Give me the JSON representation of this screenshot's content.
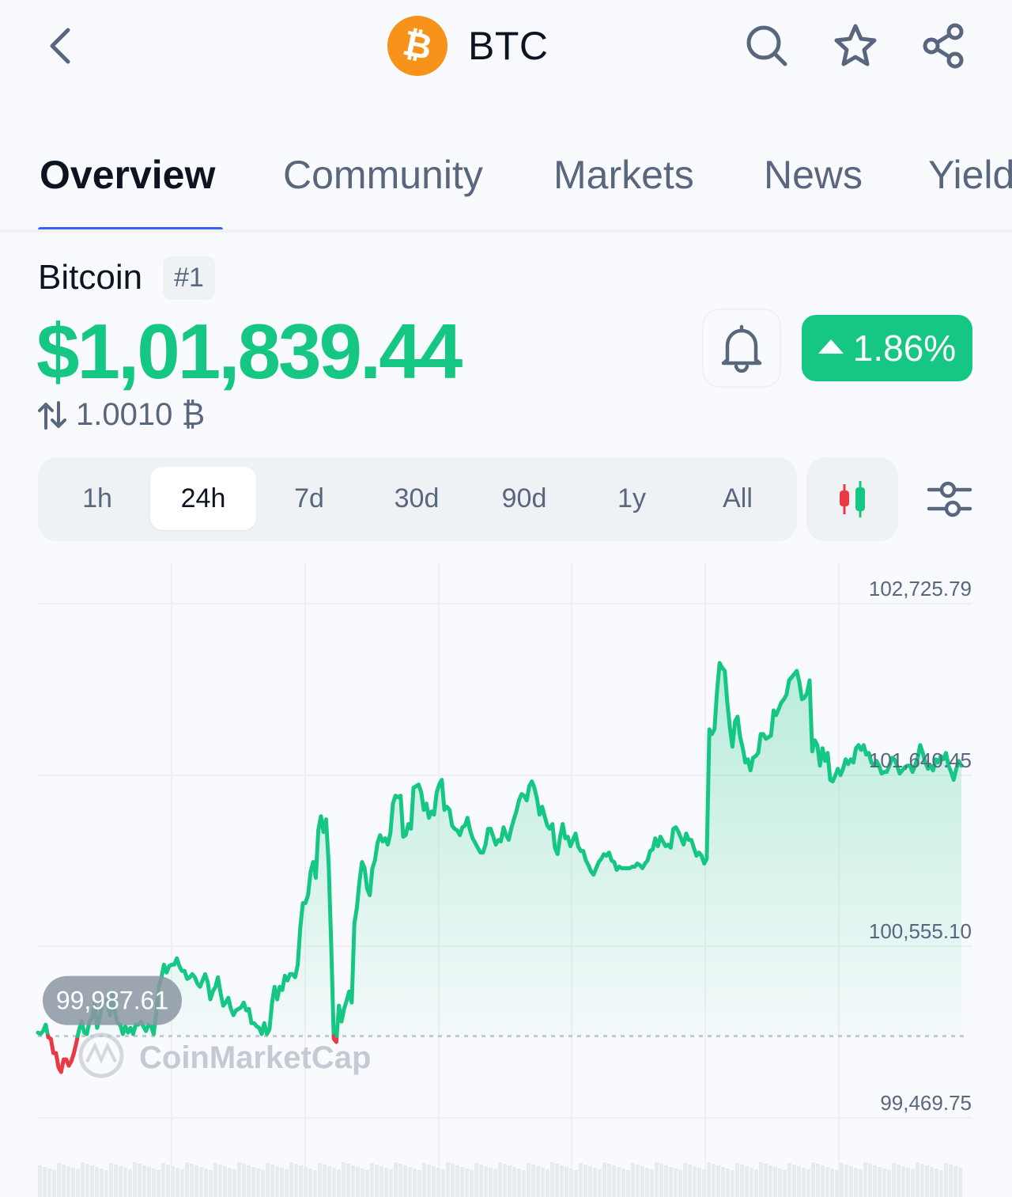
{
  "header": {
    "symbol": "BTC",
    "back_icon": "chevron-left-icon",
    "logo_icon": "bitcoin-logo-icon",
    "actions": [
      "search-icon",
      "star-icon",
      "share-icon"
    ]
  },
  "tabs": [
    {
      "label": "Overview",
      "active": true
    },
    {
      "label": "Community",
      "active": false
    },
    {
      "label": "Markets",
      "active": false
    },
    {
      "label": "News",
      "active": false
    },
    {
      "label": "Yield",
      "active": false
    }
  ],
  "coin": {
    "name": "Bitcoin",
    "rank": "#1",
    "price": "$1,01,839.44",
    "btc_value": "1.0010 ₿",
    "change": "1.86%",
    "change_direction": "up"
  },
  "ranges": [
    {
      "label": "1h",
      "active": false
    },
    {
      "label": "24h",
      "active": true
    },
    {
      "label": "7d",
      "active": false
    },
    {
      "label": "30d",
      "active": false
    },
    {
      "label": "90d",
      "active": false
    },
    {
      "label": "1y",
      "active": false
    },
    {
      "label": "All",
      "active": false
    }
  ],
  "colors": {
    "up": "#16c784",
    "down": "#ea3943",
    "accent": "#3861fb",
    "bitcoin": "#f7931a"
  },
  "chart_data": {
    "type": "area",
    "y_ticks": [
      "102,725.79",
      "101,640.45",
      "100,555.10",
      "99,469.75"
    ],
    "y_tick_values": [
      102725.79,
      101640.45,
      100555.1,
      99469.75
    ],
    "ylim": [
      99469.75,
      102725.79
    ],
    "baseline_label": "99,987.61",
    "baseline": 99987.61,
    "watermark": "CoinMarketCap",
    "grid": true,
    "values": [
      100010,
      100000,
      100020,
      100060,
      99980,
      99970,
      99880,
      99880,
      99790,
      99760,
      99840,
      99840,
      99800,
      99830,
      99880,
      99950,
      100030,
      100080,
      100010,
      100000,
      100080,
      100100,
      100200,
      100040,
      100100,
      100220,
      100220,
      100200,
      100120,
      100250,
      100130,
      100070,
      100060,
      100000,
      100050,
      100010,
      100040,
      100000,
      100060,
      100060,
      100080,
      100050,
      100020,
      100060,
      100050,
      100000,
      100140,
      100300,
      100360,
      100440,
      100390,
      100430,
      100440,
      100440,
      100480,
      100430,
      100400,
      100400,
      100350,
      100360,
      100380,
      100360,
      100320,
      100300,
      100340,
      100380,
      100330,
      100220,
      100270,
      100300,
      100360,
      100260,
      100180,
      100200,
      100230,
      100160,
      100120,
      100150,
      100160,
      100170,
      100200,
      100150,
      100160,
      100070,
      100070,
      100050,
      100040,
      100000,
      100070,
      100000,
      100030,
      100200,
      100300,
      100220,
      100300,
      100280,
      100370,
      100340,
      100380,
      100380,
      100360,
      100440,
      100680,
      100830,
      100830,
      100880,
      101030,
      101090,
      100990,
      101290,
      101380,
      101280,
      101360,
      101090,
      100570,
      99970,
      99950,
      100180,
      100080,
      100160,
      100210,
      100270,
      100200,
      100700,
      100800,
      100970,
      101090,
      101050,
      100920,
      100880,
      101050,
      101100,
      101210,
      101260,
      101220,
      101240,
      101200,
      101270,
      101460,
      101510,
      101500,
      101510,
      101250,
      101260,
      101330,
      101300,
      101560,
      101570,
      101580,
      101530,
      101420,
      101460,
      101370,
      101410,
      101390,
      101530,
      101580,
      101610,
      101420,
      101440,
      101420,
      101320,
      101300,
      101290,
      101260,
      101310,
      101320,
      101370,
      101290,
      101240,
      101210,
      101180,
      101150,
      101150,
      101200,
      101300,
      101300,
      101250,
      101200,
      101230,
      101220,
      101310,
      101260,
      101230,
      101300,
      101360,
      101410,
      101480,
      101520,
      101510,
      101480,
      101570,
      101600,
      101560,
      101490,
      101390,
      101440,
      101380,
      101320,
      101300,
      101330,
      101180,
      101140,
      101250,
      101330,
      101240,
      101250,
      101190,
      101230,
      101270,
      101190,
      101160,
      101160,
      101100,
      101070,
      101030,
      101010,
      101050,
      101090,
      101110,
      101140,
      101130,
      101150,
      101100,
      101090,
      101040,
      101060,
      101050,
      101050,
      101050,
      101050,
      101060,
      101060,
      101080,
      101070,
      101050,
      101080,
      101100,
      101160,
      101170,
      101240,
      101190,
      101250,
      101220,
      101190,
      101200,
      101180,
      101300,
      101310,
      101280,
      101240,
      101200,
      101270,
      101230,
      101230,
      101180,
      101130,
      101150,
      101130,
      101080,
      101110,
      101930,
      101900,
      101930,
      102170,
      102350,
      102320,
      102300,
      102100,
      101940,
      101820,
      101980,
      102010,
      101880,
      101810,
      101720,
      101740,
      101670,
      101750,
      101760,
      101780,
      101900,
      101900,
      101870,
      101880,
      101890,
      102050,
      102020,
      102060,
      102100,
      102120,
      102150,
      102240,
      102260,
      102280,
      102300,
      102230,
      102120,
      102130,
      102160,
      102240,
      101790,
      101860,
      101830,
      101700,
      101810,
      101730,
      101780,
      101610,
      101600,
      101640,
      101680,
      101640,
      101680,
      101740,
      101710,
      101740,
      101720,
      101810,
      101830,
      101800,
      101830,
      101770,
      101780,
      101720,
      101700,
      101730,
      101700,
      101650,
      101660,
      101660,
      101700,
      101750,
      101740,
      101700,
      101650,
      101670,
      101690,
      101700,
      101700,
      101660,
      101700,
      101750,
      101830,
      101780,
      101720,
      101680,
      101700,
      101670,
      101740,
      101720,
      101760,
      101740,
      101780,
      101700,
      101660,
      101610,
      101680,
      101730,
      101700
    ]
  }
}
